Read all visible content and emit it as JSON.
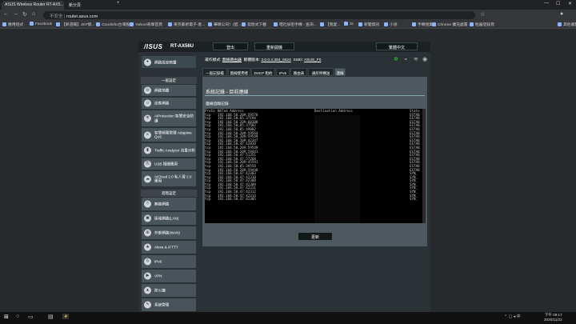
{
  "browser": {
    "tabs": [
      {
        "label": "ASUS Wireless Router RT-AX5...",
        "active": true
      },
      {
        "label": "新分頁",
        "active": false
      }
    ],
    "address_prefix": "不安全",
    "url": "router.asus.com",
    "bookmarks": [
      "應用程式",
      "Facebook",
      "【新週報】JKF情...",
      "Goodinfo!台灣股...",
      "Yahoo!奇摩首頁",
      "東京藝術電子-產...",
      "華碩公司！(搭...",
      "寫程式下載",
      "暗社加密手機 - 查詢...",
      "【我愛...",
      "3c",
      "新聞資訊",
      "小說",
      "手機搜集",
      "Chrome 擴充處置",
      "粒器登錄頁",
      "其他書籤"
    ]
  },
  "router": {
    "logo": "/ISUS",
    "model": "RT-AX56U",
    "top_buttons": [
      "登出",
      "重新開機"
    ],
    "language": "繁體中文",
    "info": {
      "mode_label": "運作模式:",
      "mode_value": "無線路由器",
      "firmware_label": "韌體版本:",
      "firmware_value": "3.0.0.4.384_9424",
      "ssid_label": "SSID:",
      "ssid_value": "ASUS_F0"
    },
    "sidebar": {
      "quick": "網路設定精靈",
      "general_head": "一般設定",
      "general": [
        "網路地圖",
        "訪客網路",
        "AiProtection 智慧安全防護",
        "智慧頻寬管理 Adaptive QoS",
        "Traffic Analyzer 流量分析",
        "USB 相關應用",
        "AiCloud 2.0 私人雲 2.0 應用"
      ],
      "advanced_head": "進階設定",
      "advanced": [
        "無線網路",
        "區域網路(LAN)",
        "外部網路(WAN)",
        "Alexa & IFTTT",
        "IPv6",
        "VPN",
        "防火牆",
        "系統管理"
      ]
    },
    "tabs": [
      "一般記錄檔",
      "無線使用者",
      "DHCP 租約",
      "IPv6",
      "路由表",
      "通訊埠轉送",
      "連線"
    ],
    "active_tab": "連線",
    "panel": {
      "title": "系統記錄 - 目前連線",
      "subtitle": "連線追蹤記錄",
      "columns": [
        "Proto",
        "NATed Address",
        "Destination Address",
        "State"
      ],
      "rows": [
        [
          "tcp",
          "192.168.50.209:59570",
          "ESTAB"
        ],
        [
          "tcp",
          "192.168.50.85:37194",
          "ESTAB"
        ],
        [
          "tcp",
          "192.168.50.209:60300",
          "ESTAB"
        ],
        [
          "tcp",
          "192.168.50.85:37582",
          "ESTAB"
        ],
        [
          "tcp",
          "192.168.50.85:49002",
          "ESTAB"
        ],
        [
          "tcp",
          "192.168.50.209:59564",
          "ESTAB"
        ],
        [
          "tcp",
          "192.168.50.209:59549",
          "ESTAB"
        ],
        [
          "tcp",
          "192.168.50.209:42347",
          "ESTAB"
        ],
        [
          "tcp",
          "192.168.50.47:42839",
          "ESTAB"
        ],
        [
          "tcp",
          "192.168.50.209:59549",
          "ESTAB"
        ],
        [
          "tcp",
          "192.168.50.209:59441",
          "ESTAB"
        ],
        [
          "tcp",
          "192.168.50.47:51351",
          "ESTAB"
        ],
        [
          "tcp",
          "192.168.50.47:57268",
          "ESTAB"
        ],
        [
          "tcp",
          "192.168.50.209:45591",
          "ESTAB"
        ],
        [
          "tcp",
          "192.168.50.85:39558",
          "ESTAB"
        ],
        [
          "tcp",
          "192.168.50.209:59440",
          "ESTAB"
        ],
        [
          "tcp",
          "192.168.50.47:42303",
          "SYN_"
        ],
        [
          "tcp",
          "192.168.50.47:42310",
          "SYN_"
        ],
        [
          "tcp",
          "192.168.50.47:42308",
          "SYN_"
        ],
        [
          "tcp",
          "192.168.50.47:42309",
          "SYN_"
        ],
        [
          "tcp",
          "192.168.50.47:42311",
          "SYN_"
        ],
        [
          "tcp",
          "192.168.50.47:42312",
          "SYN_"
        ],
        [
          "tcp",
          "192.168.50.47:42313",
          "SYN_"
        ],
        [
          "tcp",
          "192.168.50.47:42305",
          "SYN_"
        ]
      ],
      "refresh": "更新"
    }
  },
  "taskbar": {
    "time": "下午 09:17",
    "date": "2020/11/22"
  }
}
